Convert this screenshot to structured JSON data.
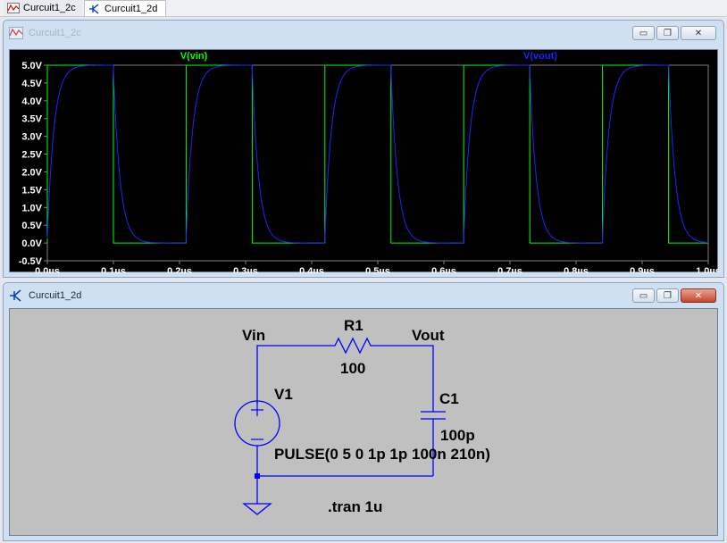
{
  "tabs": [
    {
      "label": "Curcuit1_2c",
      "icon": "waveform-icon"
    },
    {
      "label": "Curcuit1_2d",
      "icon": "schematic-icon"
    }
  ],
  "plot_window": {
    "title": "Curcuit1_2c",
    "traces": [
      {
        "label": "V(vin)",
        "color": "#00ff00"
      },
      {
        "label": "V(vout)",
        "color": "#2222ff"
      }
    ],
    "colors": {
      "background": "#000000",
      "axis": "#808080",
      "tick_text": "#ffffff"
    }
  },
  "chart_data": {
    "type": "line",
    "x_ticks": [
      "0.0µs",
      "0.1µs",
      "0.2µs",
      "0.3µs",
      "0.4µs",
      "0.5µs",
      "0.6µs",
      "0.7µs",
      "0.8µs",
      "0.9µs",
      "1.0µs"
    ],
    "y_ticks": [
      "5.0V",
      "4.5V",
      "4.0V",
      "3.5V",
      "3.0V",
      "2.5V",
      "2.0V",
      "1.5V",
      "1.0V",
      "0.5V",
      "0.0V",
      "-0.5V"
    ],
    "xlim": [
      0,
      1.0
    ],
    "ylim": [
      -0.5,
      5.0
    ],
    "x_unit": "µs",
    "y_unit": "V",
    "series": [
      {
        "name": "V(vin)",
        "kind": "pulse",
        "v1": 0,
        "v2": 5,
        "delay": 0,
        "width": 0.1,
        "period": 0.21
      },
      {
        "name": "V(vout)",
        "kind": "rc_response",
        "tau": 0.01
      }
    ]
  },
  "schematic_window": {
    "title": "Curcuit1_2d",
    "labels": {
      "vin": "Vin",
      "vout": "Vout",
      "r1_name": "R1",
      "r1_value": "100",
      "c1_name": "C1",
      "c1_value": "100p",
      "v1_name": "V1",
      "v1_value": "PULSE(0 5 0 1p 1p 100n 210n)",
      "directive": ".tran 1u"
    },
    "colors": {
      "wire": "#0000ff",
      "text": "#000000",
      "background": "#c0c0c0"
    }
  },
  "window_buttons": {
    "minimize": "▭",
    "restore": "❐",
    "close": "✕"
  }
}
